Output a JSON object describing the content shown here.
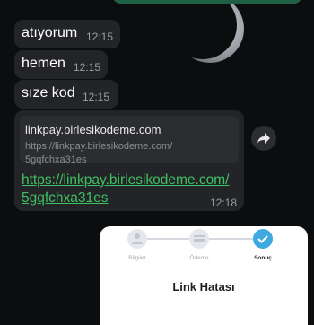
{
  "messages": [
    {
      "text": "atıyorum",
      "time": "12:15"
    },
    {
      "text": "hemen",
      "time": "12:15"
    },
    {
      "text": "sıze kod",
      "time": "12:15"
    }
  ],
  "link_message": {
    "preview_title": "linkpay.birlesikodeme.com",
    "preview_url_line1": "https://linkpay.birlesikodeme.com/",
    "preview_url_line2": "5gqfchxa31es",
    "link_line1": "https://linkpay.birlesikodeme.com/",
    "link_line2": "5gqfchxa31es",
    "time": "12:18"
  },
  "embedded_card": {
    "steps": [
      "Bilgiler",
      "Ödeme",
      "Sonuç"
    ],
    "active_step": "Sonuç",
    "title": "Link Hatası"
  },
  "colors": {
    "incoming_bubble": "#232427",
    "link": "#3fc061",
    "step_active": "#3ea9e0"
  }
}
